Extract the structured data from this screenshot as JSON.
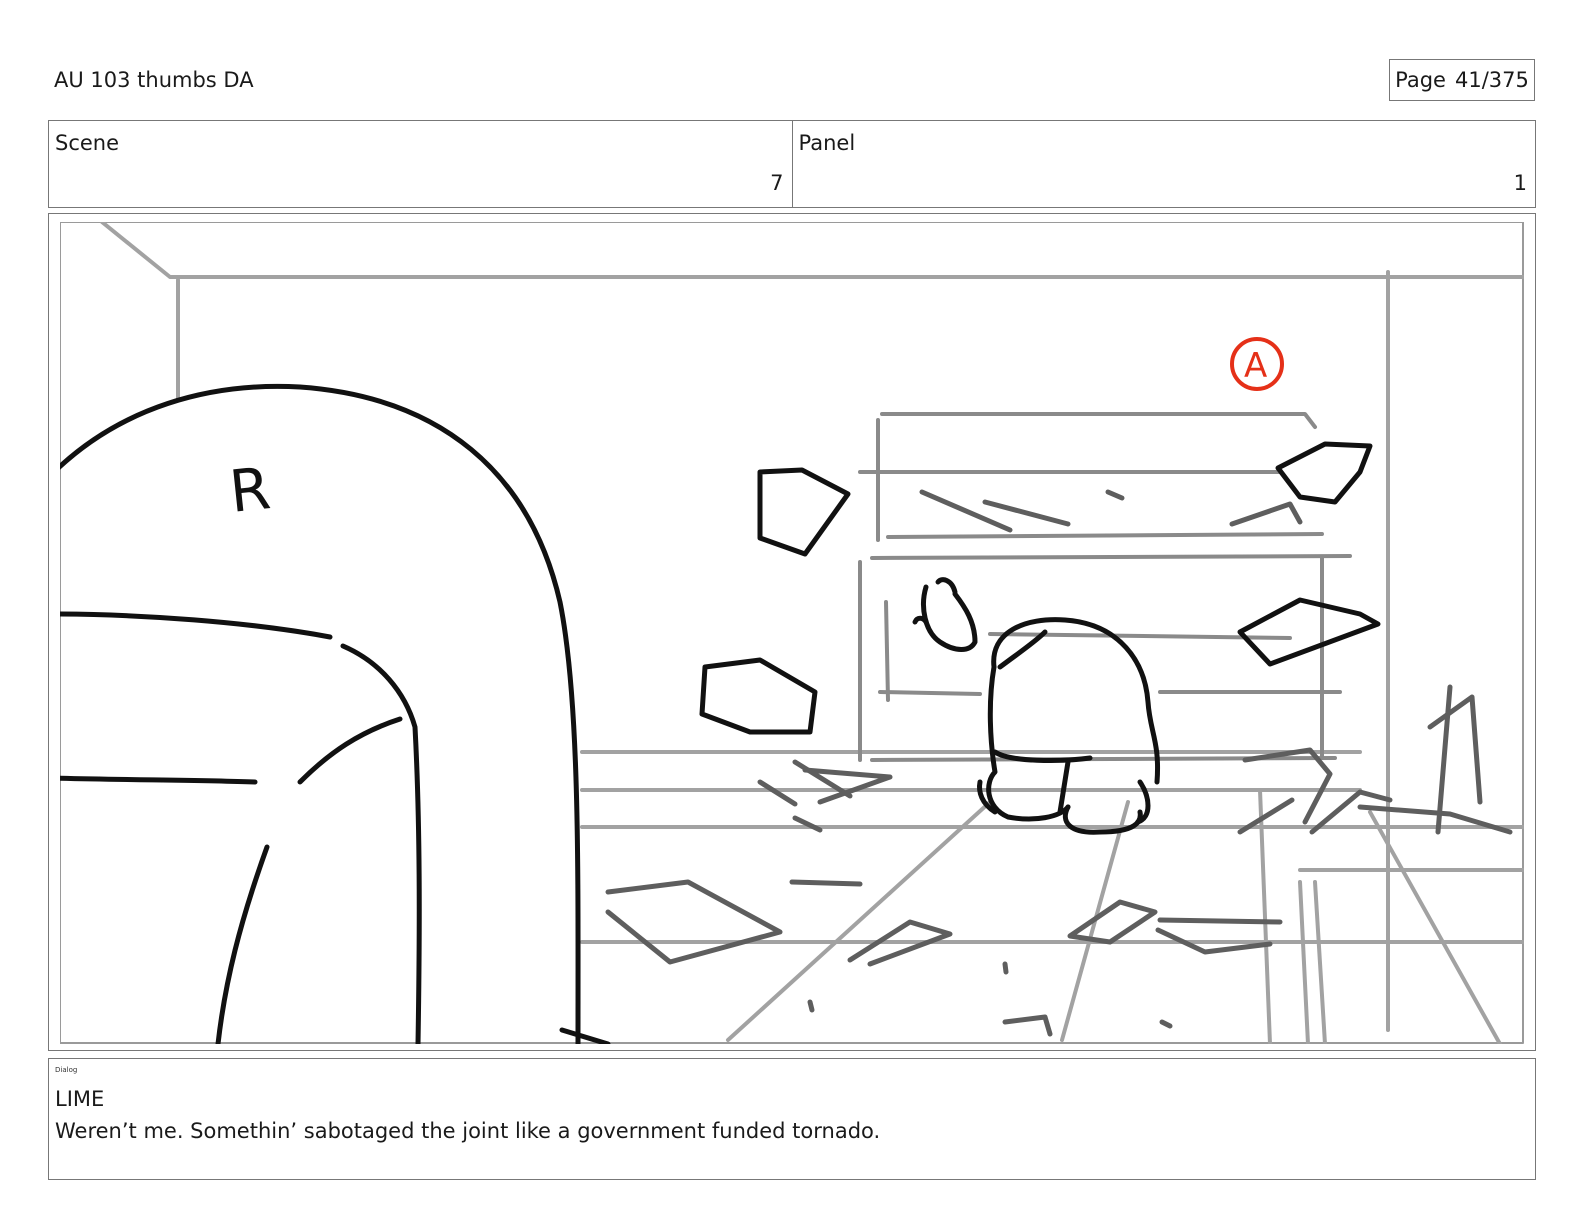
{
  "header": {
    "title": "AU 103 thumbs DA",
    "page_label": "Page",
    "page_value": "41/375"
  },
  "meta": {
    "scene_label": "Scene",
    "scene_value": "7",
    "panel_label": "Panel",
    "panel_value": "1"
  },
  "panel": {
    "character_marker_left": "R",
    "character_marker_right": "A",
    "marker_color": "#e53018"
  },
  "dialog": {
    "label": "Dialog",
    "speaker": "LIME",
    "line": "Weren’t me. Somethin’ sabotaged the joint like a government funded tornado."
  }
}
